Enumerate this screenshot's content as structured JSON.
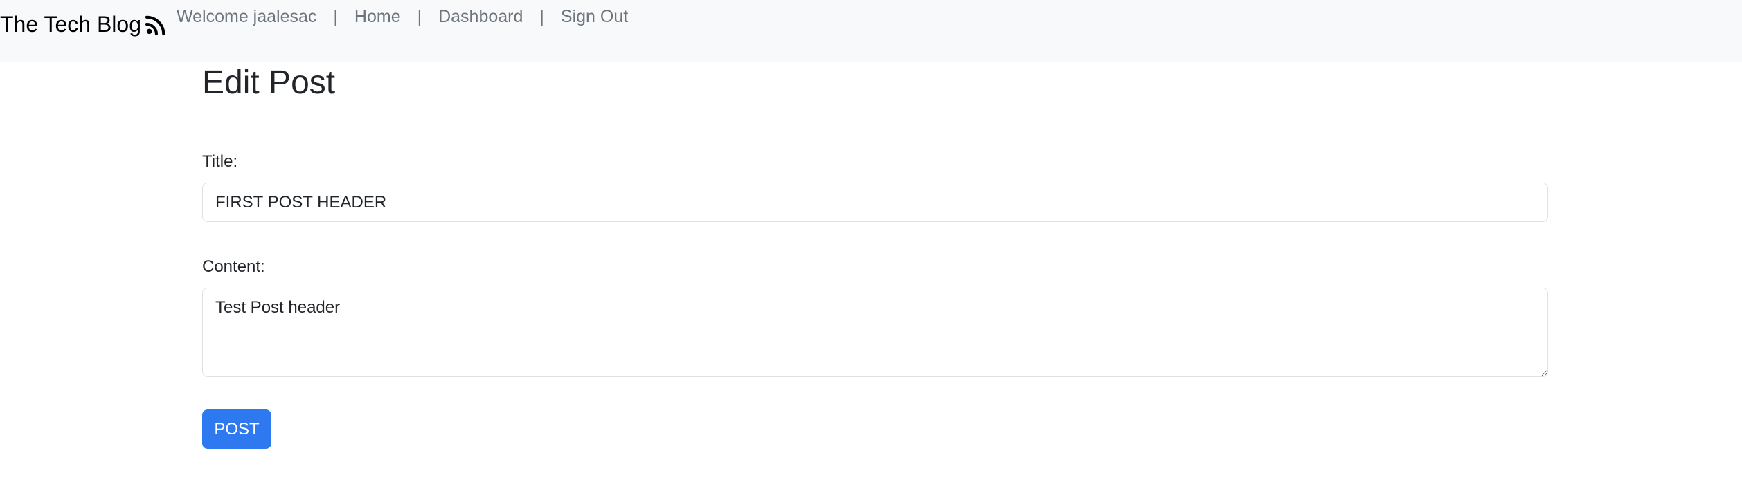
{
  "navbar": {
    "brand": "The Tech Blog",
    "brand_icon": "rss-icon",
    "welcome": "Welcome jaalesac",
    "separator": "|",
    "links": {
      "home": "Home",
      "dashboard": "Dashboard",
      "sign_out": "Sign Out"
    }
  },
  "form": {
    "heading": "Edit Post",
    "title_label": "Title:",
    "title_value": "FIRST POST HEADER",
    "content_label": "Content:",
    "content_value": "Test Post header",
    "submit_label": "POST"
  },
  "colors": {
    "navbar_bg": "#f8f9fa",
    "nav_text": "#6c757d",
    "primary": "#2f79f0"
  }
}
